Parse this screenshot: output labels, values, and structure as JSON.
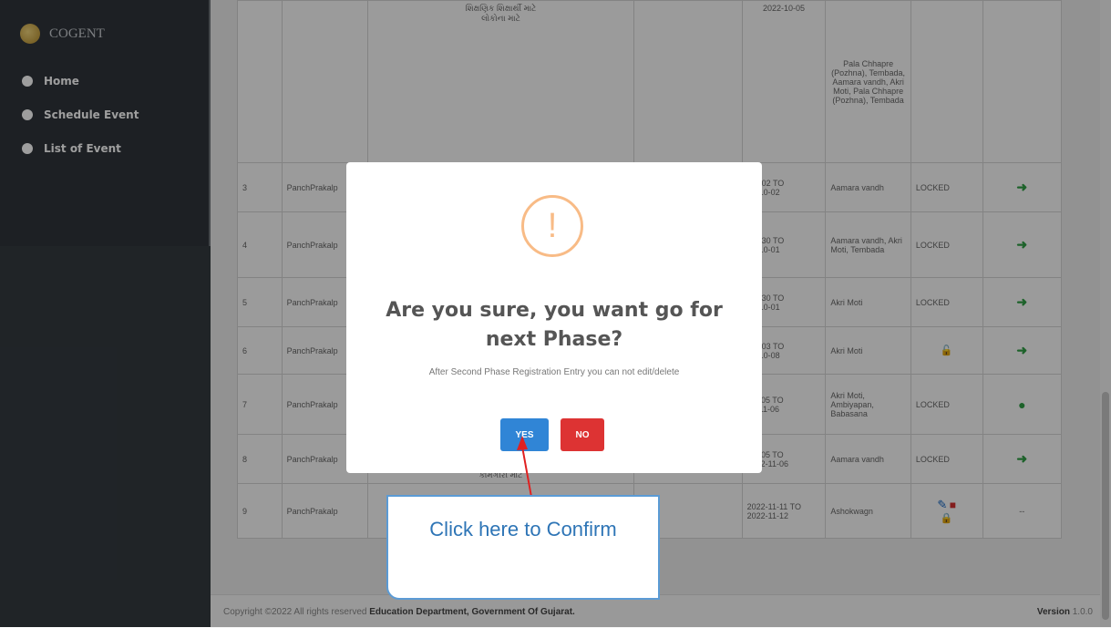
{
  "app": {
    "brand": "COGENT"
  },
  "sidebar": {
    "items": [
      {
        "label": "Home"
      },
      {
        "label": "Schedule Event"
      },
      {
        "label": "List of Event"
      }
    ]
  },
  "table": {
    "top": {
      "description": "શિક્ષણિક શિક્ષાર્થી માટે\nલોકોના માટે",
      "date": "2022-10-05",
      "venue": "Pala Chhapre (Pozhna), Tembada, Aamara vandh, Akri Moti, Pala Chhapre (Pozhna), Tembada"
    },
    "rows": [
      {
        "no": "3",
        "name": "PanchPrakalp",
        "date": "-10-02 TO\n22-10-02",
        "venue": "Aamara vandh",
        "status": "LOCKED",
        "action": "arrow"
      },
      {
        "no": "4",
        "name": "PanchPrakalp",
        "date": "-09-30 TO\n22-10-01",
        "venue": "Aamara vandh, Akri Moti, Tembada",
        "status": "LOCKED",
        "action": "arrow"
      },
      {
        "no": "5",
        "name": "PanchPrakalp",
        "date": "-09-30 TO\n22-10-01",
        "venue": "Akri Moti",
        "status": "LOCKED",
        "action": "arrow"
      },
      {
        "no": "6",
        "name": "PanchPrakalp",
        "date": "-10-03 TO\n22-10-08",
        "venue": "Akri Moti",
        "status": "unlock-icon",
        "action": "arrow"
      },
      {
        "no": "7",
        "name": "PanchPrakalp",
        "date": "-11-05 TO\n22-11-06",
        "venue": "Akri Moti, Ambiyapan, Babasana",
        "status": "LOCKED",
        "action": "eye"
      },
      {
        "no": "8",
        "name": "PanchPrakalp",
        "desc": "કામગીરી માટે",
        "date": "-11-05 TO\n2022-11-06",
        "venue": "Aamara vandh",
        "status": "LOCKED",
        "action": "arrow"
      },
      {
        "no": "9",
        "name": "PanchPrakalp",
        "date": "2022-11-11 TO\n2022-11-12",
        "venue": "Ashokwagn",
        "status": "edit-delete-lock",
        "action": "--"
      }
    ]
  },
  "modal": {
    "icon": "!",
    "title": "Are you sure, you want go for next Phase?",
    "text": "After Second Phase Registration Entry you can not edit/delete",
    "yes_label": "YES",
    "no_label": "NO"
  },
  "callout": {
    "text": "Click here to Confirm"
  },
  "footer": {
    "copyright": "Copyright ©2022 All rights reserved",
    "org": "Education Department, Government Of Gujarat.",
    "version_label": "Version",
    "version": "1.0.0"
  },
  "colors": {
    "sidebar": "#343a40",
    "yes": "#3085d6",
    "no": "#dd3333",
    "callout": "#5b9bd5",
    "warning": "#f8bb86"
  }
}
